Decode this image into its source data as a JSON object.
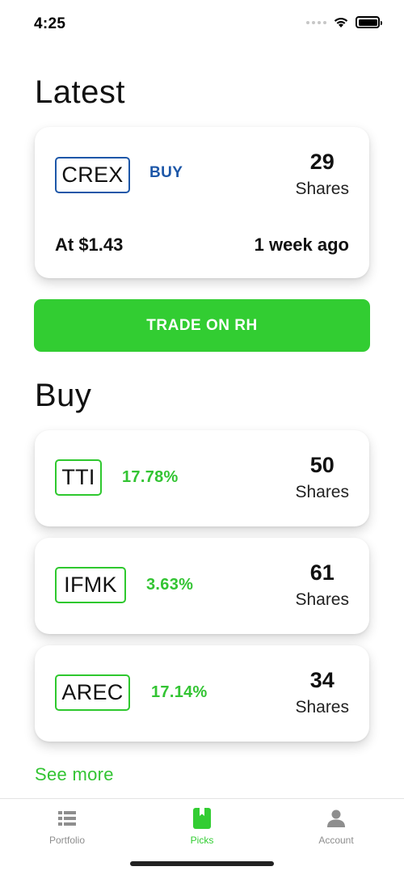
{
  "status_bar": {
    "time": "4:25"
  },
  "latest": {
    "heading": "Latest",
    "ticker": "CREX",
    "action": "BUY",
    "shares": "29",
    "shares_label": "Shares",
    "price": "At $1.43",
    "time_ago": "1 week ago"
  },
  "trade_button_label": "TRADE ON RH",
  "buy": {
    "heading": "Buy",
    "items": [
      {
        "ticker": "TTI",
        "change": "17.78%",
        "shares": "50",
        "shares_label": "Shares"
      },
      {
        "ticker": "IFMK",
        "change": "3.63%",
        "shares": "61",
        "shares_label": "Shares"
      },
      {
        "ticker": "AREC",
        "change": "17.14%",
        "shares": "34",
        "shares_label": "Shares"
      }
    ],
    "see_more": "See more"
  },
  "tabs": [
    {
      "label": "Portfolio",
      "icon": "list-icon",
      "active": false
    },
    {
      "label": "Picks",
      "icon": "bookmark-icon",
      "active": true
    },
    {
      "label": "Account",
      "icon": "person-icon",
      "active": false
    }
  ],
  "colors": {
    "accent_green": "#32cd32",
    "buy_blue": "#1d57a8",
    "inactive_gray": "#8e8e8e"
  }
}
